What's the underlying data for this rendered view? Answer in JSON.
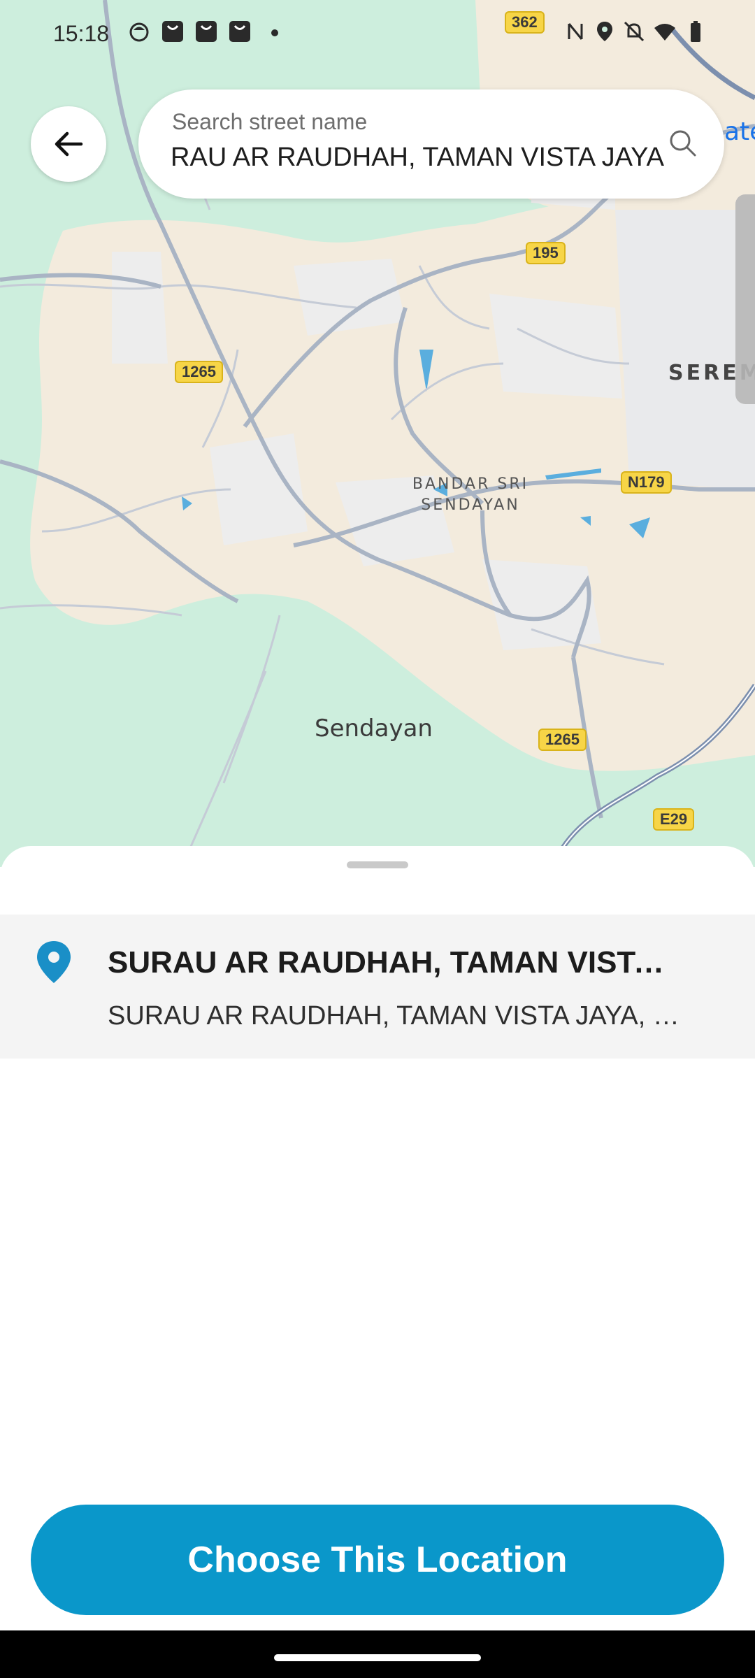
{
  "status_bar": {
    "time": "15:18",
    "icons": [
      "app-notification-icon",
      "shopping-bag-icon",
      "shopping-bag-icon",
      "shopping-bag-icon",
      "nfc-icon",
      "location-icon",
      "bell-off-icon",
      "wifi-icon",
      "battery-icon"
    ]
  },
  "map": {
    "road_shields": [
      "362",
      "195",
      "1265",
      "N179",
      "1265",
      "E29"
    ],
    "labels": {
      "area_line1": "BANDAR SRI",
      "area_line2": "SENDAYAN",
      "town": "Sendayan",
      "city": "SEREM",
      "partial": "ate"
    },
    "colors": {
      "land": "#f3ebdd",
      "green": "#cdeedd",
      "road": "#a9b4c4",
      "water": "#5aaede",
      "highway": "#7c8fae"
    }
  },
  "search": {
    "placeholder": "Search street name",
    "value": "SURAU AR RAUDHAH, TAMAN VISTA JAYA"
  },
  "results": [
    {
      "title": "SURAU AR RAUDHAH, TAMAN VISTA J…",
      "subtitle": "SURAU AR RAUDHAH, TAMAN VISTA JAYA, Por..."
    }
  ],
  "actions": {
    "choose_label": "Choose This Location"
  },
  "colors": {
    "accent": "#0a97ca",
    "pin": "#1a8fc7"
  }
}
